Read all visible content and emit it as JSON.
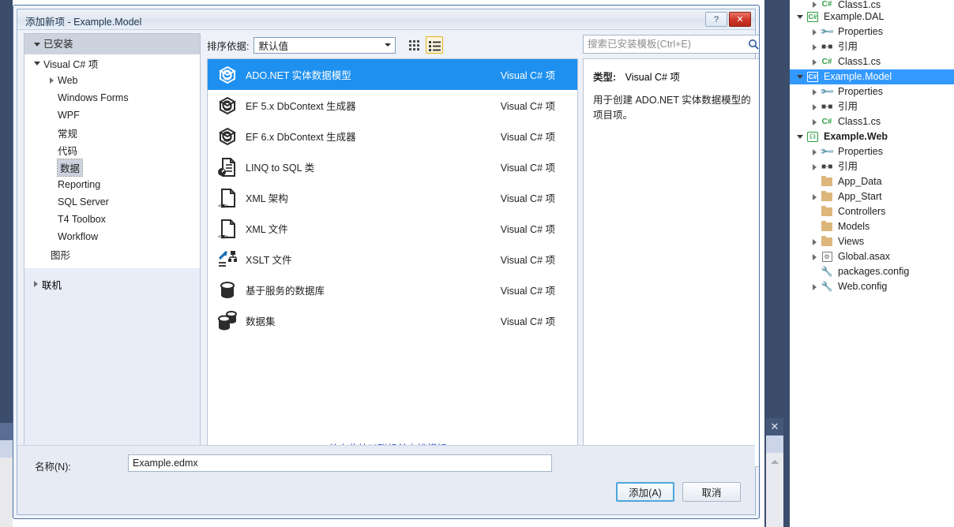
{
  "dialog": {
    "title": "添加新项 - Example.Model",
    "help_button": "?",
    "close_button": "✕"
  },
  "left_panel": {
    "header": "已安装",
    "tree": [
      {
        "label": "Visual C# 项",
        "indent": 0,
        "expander": "down",
        "selected": false
      },
      {
        "label": "Web",
        "indent": 1,
        "expander": "right",
        "selected": false
      },
      {
        "label": "Windows Forms",
        "indent": 1,
        "expander": "none",
        "selected": false
      },
      {
        "label": "WPF",
        "indent": 1,
        "expander": "none",
        "selected": false
      },
      {
        "label": "常规",
        "indent": 1,
        "expander": "none",
        "selected": false
      },
      {
        "label": "代码",
        "indent": 1,
        "expander": "none",
        "selected": false
      },
      {
        "label": "数据",
        "indent": 1,
        "expander": "none",
        "selected": true
      },
      {
        "label": "Reporting",
        "indent": 1,
        "expander": "none",
        "selected": false
      },
      {
        "label": "SQL Server",
        "indent": 1,
        "expander": "none",
        "selected": false
      },
      {
        "label": "T4 Toolbox",
        "indent": 1,
        "expander": "none",
        "selected": false
      },
      {
        "label": "Workflow",
        "indent": 1,
        "expander": "none",
        "selected": false
      },
      {
        "label": "图形",
        "indent": 0.5,
        "expander": "none",
        "selected": false
      }
    ],
    "online": {
      "label": "联机",
      "expander": "right"
    }
  },
  "toolbar": {
    "sort_label": "排序依据:",
    "sort_value": "默认值",
    "view_small_icons": "small-icons-view",
    "view_list": "list-view"
  },
  "search": {
    "placeholder": "搜索已安装模板(Ctrl+E)",
    "value": "",
    "icon": "search-icon"
  },
  "templates": [
    {
      "name": "ADO.NET 实体数据模型",
      "kind": "Visual C# 项",
      "icon": "edmx-icon",
      "selected": true
    },
    {
      "name": "EF 5.x DbContext 生成器",
      "kind": "Visual C# 项",
      "icon": "edmx-icon",
      "selected": false
    },
    {
      "name": "EF 6.x DbContext 生成器",
      "kind": "Visual C# 项",
      "icon": "edmx-icon",
      "selected": false
    },
    {
      "name": "LINQ to SQL 类",
      "kind": "Visual C# 项",
      "icon": "linq-icon",
      "selected": false
    },
    {
      "name": "XML 架构",
      "kind": "Visual C# 项",
      "icon": "xml-icon",
      "selected": false
    },
    {
      "name": "XML 文件",
      "kind": "Visual C# 项",
      "icon": "xml-icon",
      "selected": false
    },
    {
      "name": "XSLT 文件",
      "kind": "Visual C# 项",
      "icon": "xslt-icon",
      "selected": false
    },
    {
      "name": "基于服务的数据库",
      "kind": "Visual C# 项",
      "icon": "database-icon",
      "selected": false
    },
    {
      "name": "数据集",
      "kind": "Visual C# 项",
      "icon": "dataset-icon",
      "selected": false
    }
  ],
  "online_link": "单击此处以联机并查找模板。",
  "description": {
    "type_label": "类型:",
    "type_value": "Visual C# 项",
    "text": "用于创建 ADO.NET 实体数据模型的项目项。"
  },
  "footer": {
    "name_label": "名称(N):",
    "name_value": "Example.edmx",
    "add_button": "添加(A)",
    "cancel_button": "取消"
  },
  "solution_explorer": {
    "items": [
      {
        "label": "Class1.cs",
        "indent": 1,
        "expander": "right",
        "icon": "cs-file-icon",
        "selected": false,
        "bold": false,
        "partial": true
      },
      {
        "label": "Example.DAL",
        "indent": 0,
        "expander": "down",
        "icon": "csproj-icon",
        "selected": false,
        "bold": false
      },
      {
        "label": "Properties",
        "indent": 1,
        "expander": "right",
        "icon": "wrench-icon",
        "selected": false,
        "bold": false
      },
      {
        "label": "引用",
        "indent": 1,
        "expander": "right",
        "icon": "references-icon",
        "selected": false,
        "bold": false
      },
      {
        "label": "Class1.cs",
        "indent": 1,
        "expander": "right",
        "icon": "cs-file-icon",
        "selected": false,
        "bold": false
      },
      {
        "label": "Example.Model",
        "indent": 0,
        "expander": "down",
        "icon": "csproj-icon",
        "selected": true,
        "bold": false
      },
      {
        "label": "Properties",
        "indent": 1,
        "expander": "right",
        "icon": "wrench-icon",
        "selected": false,
        "bold": false
      },
      {
        "label": "引用",
        "indent": 1,
        "expander": "right",
        "icon": "references-icon",
        "selected": false,
        "bold": false
      },
      {
        "label": "Class1.cs",
        "indent": 1,
        "expander": "right",
        "icon": "cs-file-icon",
        "selected": false,
        "bold": false
      },
      {
        "label": "Example.Web",
        "indent": 0,
        "expander": "down",
        "icon": "webproj-icon",
        "selected": false,
        "bold": true
      },
      {
        "label": "Properties",
        "indent": 1,
        "expander": "right",
        "icon": "wrench-icon",
        "selected": false,
        "bold": false
      },
      {
        "label": "引用",
        "indent": 1,
        "expander": "right",
        "icon": "references-icon",
        "selected": false,
        "bold": false
      },
      {
        "label": "App_Data",
        "indent": 1,
        "expander": "none",
        "icon": "folder-icon",
        "selected": false,
        "bold": false
      },
      {
        "label": "App_Start",
        "indent": 1,
        "expander": "right",
        "icon": "folder-icon",
        "selected": false,
        "bold": false
      },
      {
        "label": "Controllers",
        "indent": 1,
        "expander": "none",
        "icon": "folder-icon",
        "selected": false,
        "bold": false
      },
      {
        "label": "Models",
        "indent": 1,
        "expander": "none",
        "icon": "folder-icon",
        "selected": false,
        "bold": false
      },
      {
        "label": "Views",
        "indent": 1,
        "expander": "right",
        "icon": "folder-icon",
        "selected": false,
        "bold": false
      },
      {
        "label": "Global.asax",
        "indent": 1,
        "expander": "right",
        "icon": "asax-icon",
        "selected": false,
        "bold": false
      },
      {
        "label": "packages.config",
        "indent": 1,
        "expander": "none",
        "icon": "config-icon",
        "selected": false,
        "bold": false
      },
      {
        "label": "Web.config",
        "indent": 1,
        "expander": "right",
        "icon": "config-icon",
        "selected": false,
        "bold": false
      }
    ]
  },
  "shell": {
    "document_close": "✕"
  },
  "colors": {
    "selection_blue": "#1e90ef",
    "tree_selection_blue": "#3399ff",
    "link_blue": "#2b50c8",
    "shell_navy": "#3b4d6b",
    "accent_yellow": "#e0b020"
  }
}
